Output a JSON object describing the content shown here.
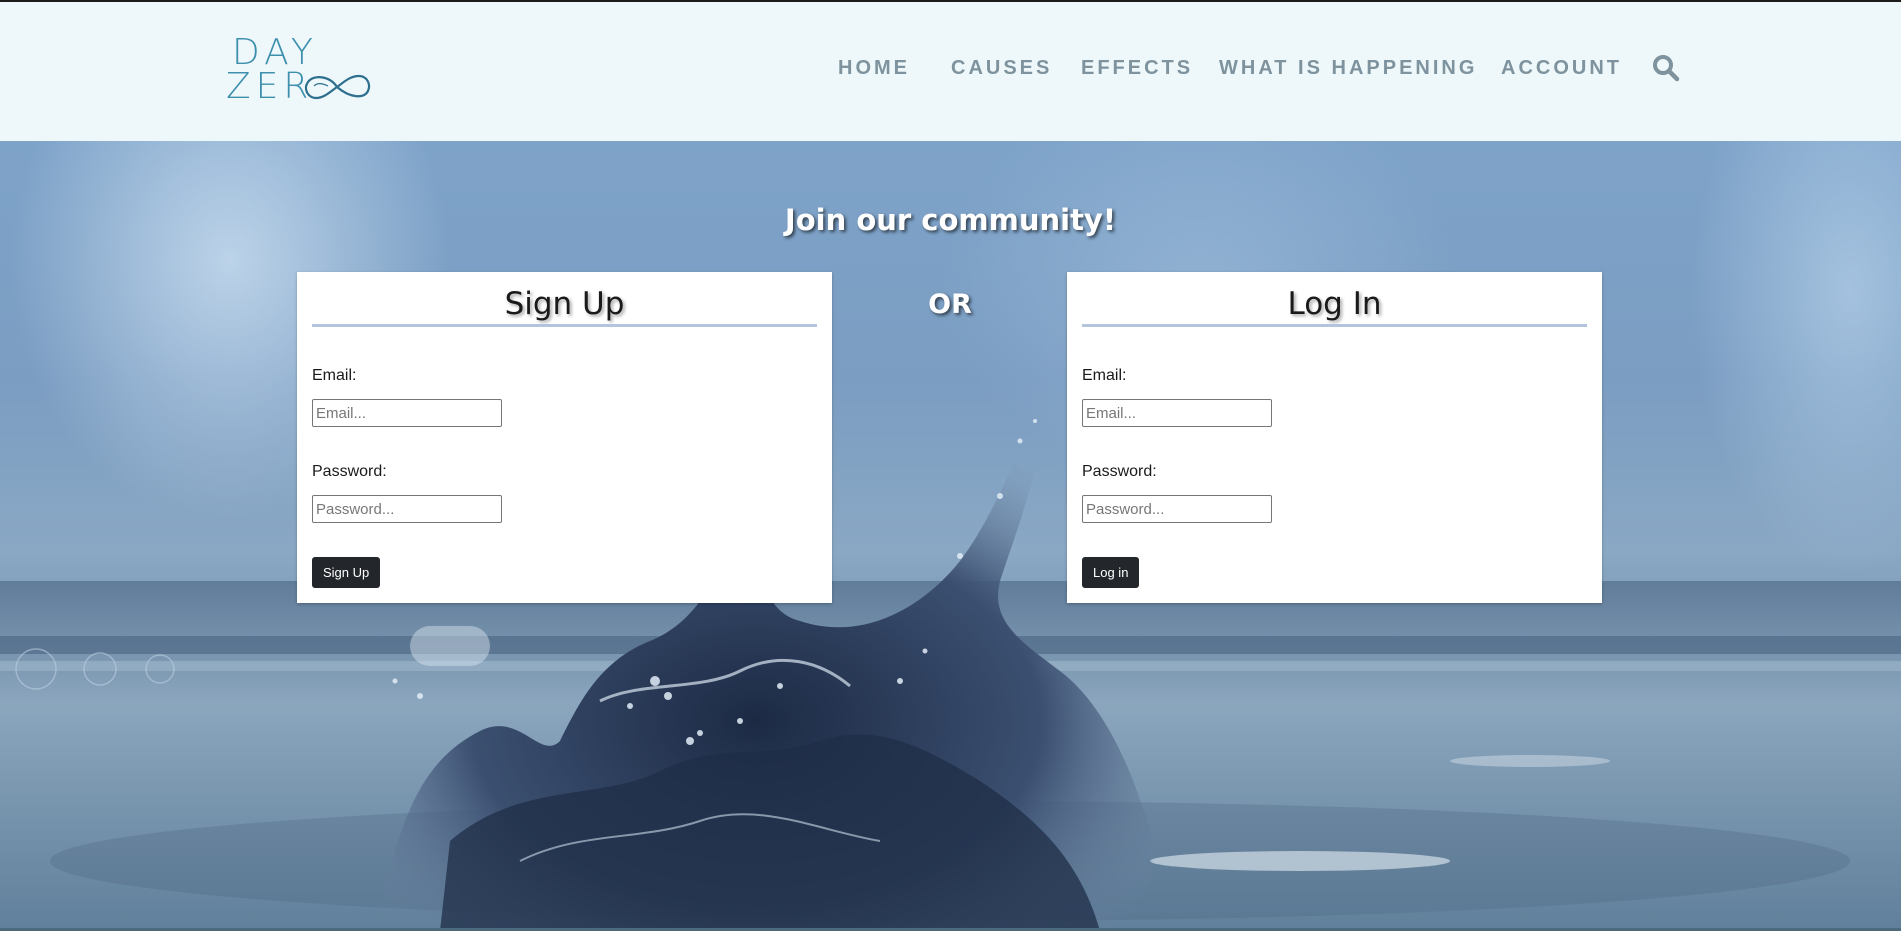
{
  "brand": {
    "logo_line1": "DAY",
    "logo_line2": "ZER"
  },
  "nav": {
    "items": [
      {
        "label": "HOME"
      },
      {
        "label": "CAUSES"
      },
      {
        "label": "EFFECTS"
      },
      {
        "label": "WHAT IS HAPPENING"
      },
      {
        "label": "ACCOUNT"
      }
    ],
    "search_icon": "search-icon"
  },
  "hero": {
    "title": "Join our community!",
    "or_text": "OR"
  },
  "signup": {
    "title": "Sign Up",
    "email_label": "Email:",
    "email_placeholder": "Email...",
    "password_label": "Password:",
    "password_placeholder": "Password...",
    "button_label": "Sign Up"
  },
  "login": {
    "title": "Log In",
    "email_label": "Email:",
    "email_placeholder": "Email...",
    "password_label": "Password:",
    "password_placeholder": "Password...",
    "button_label": "Log in"
  },
  "colors": {
    "header_bg": "#eef8fa",
    "nav_text": "#7e939e",
    "brand_blue": "#3e8fae",
    "button_bg": "#23272b",
    "rule": "#b3c4dd"
  }
}
